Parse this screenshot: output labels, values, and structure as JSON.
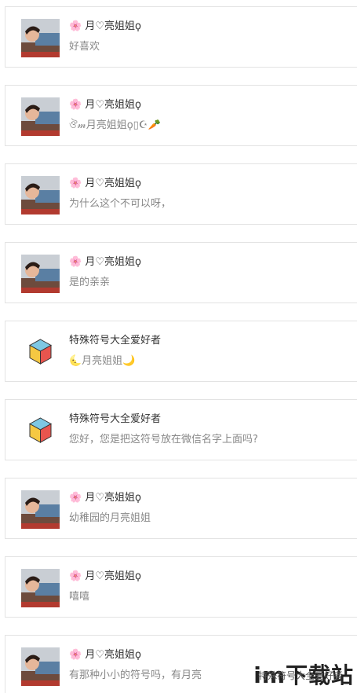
{
  "comments": [
    {
      "avatar": "photo-avatar",
      "name": "🌸 月♡亮姐姐ϙ",
      "message": "好喜欢"
    },
    {
      "avatar": "photo-avatar",
      "name": "🌸 月♡亮姐姐ϙ",
      "message": "ঔ𝓂月亮姐姐ϙ▯☪🥕"
    },
    {
      "avatar": "photo-avatar",
      "name": "🌸 月♡亮姐姐ϙ",
      "message": "为什么这个不可以呀，"
    },
    {
      "avatar": "photo-avatar",
      "name": "🌸 月♡亮姐姐ϙ",
      "message": "是的亲亲"
    },
    {
      "avatar": "cube-avatar",
      "name": "特殊符号大全爱好者",
      "message": "🌜月亮姐姐🌙"
    },
    {
      "avatar": "cube-avatar",
      "name": "特殊符号大全爱好者",
      "message": "您好，您是把这符号放在微信名字上面吗?"
    },
    {
      "avatar": "photo-avatar",
      "name": "🌸 月♡亮姐姐ϙ",
      "message": "幼稚园的月亮姐姐"
    },
    {
      "avatar": "photo-avatar",
      "name": "🌸 月♡亮姐姐ϙ",
      "message": "嘻嘻"
    },
    {
      "avatar": "photo-avatar",
      "name": "🌸 月♡亮姐姐ϙ",
      "message": "有那种小小的符号吗，有月亮"
    }
  ],
  "watermark": {
    "brand": "im下载站",
    "overlay": "特殊符号大全爱好者"
  }
}
